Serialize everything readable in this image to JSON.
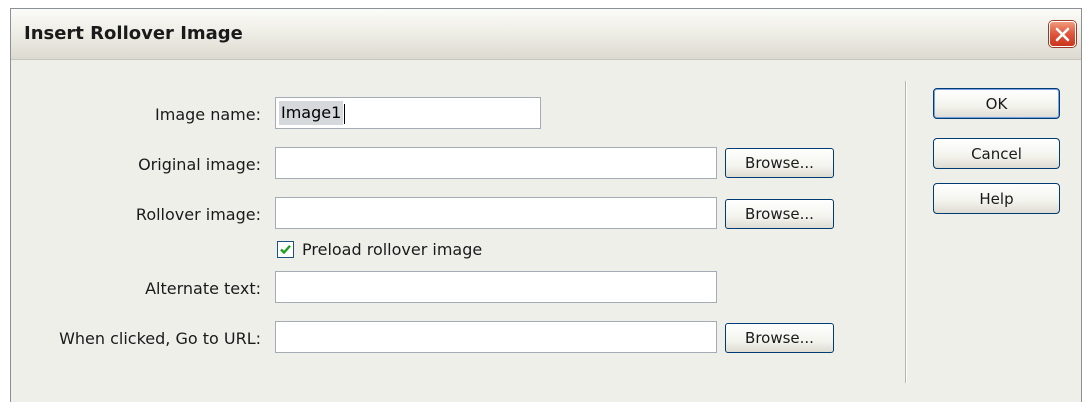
{
  "dialog": {
    "title": "Insert Rollover Image",
    "close_icon": "close-x-icon"
  },
  "form": {
    "image_name": {
      "label": "Image name:",
      "value": "Image1"
    },
    "original_image": {
      "label": "Original image:",
      "value": "",
      "browse_label": "Browse..."
    },
    "rollover_image": {
      "label": "Rollover image:",
      "value": "",
      "browse_label": "Browse..."
    },
    "preload": {
      "label": "Preload rollover image",
      "checked": true
    },
    "alternate_text": {
      "label": "Alternate text:",
      "value": ""
    },
    "go_to_url": {
      "label": "When clicked, Go to URL:",
      "value": "",
      "browse_label": "Browse..."
    }
  },
  "actions": {
    "ok_label": "OK",
    "cancel_label": "Cancel",
    "help_label": "Help"
  },
  "colors": {
    "dialog_bg": "#efefea",
    "close_button": "#e0553b",
    "button_border": "#003c74",
    "check_mark": "#21a121"
  }
}
